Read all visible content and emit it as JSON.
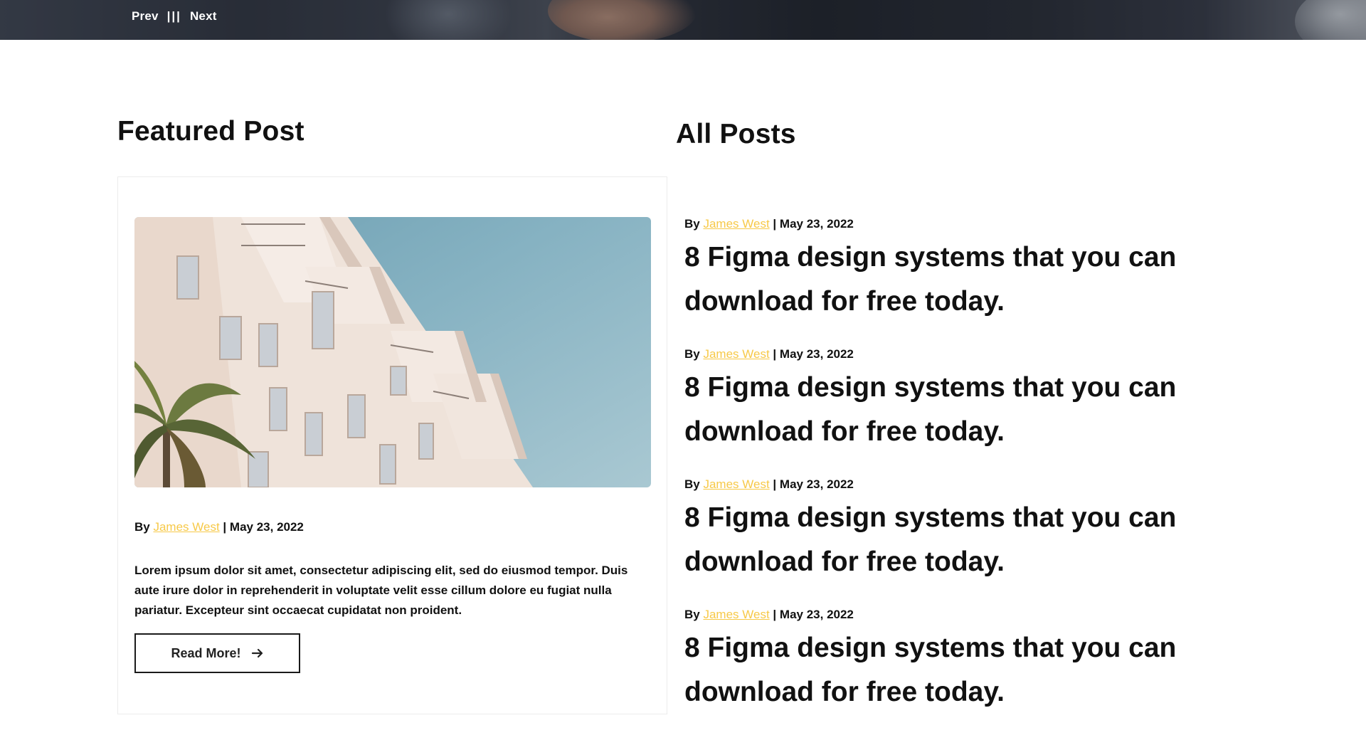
{
  "hero": {
    "prev_label": "Prev",
    "separator": "|||",
    "next_label": "Next"
  },
  "featured": {
    "heading": "Featured Post",
    "by": "By",
    "author": "James West",
    "date_sep": "|",
    "date": "May 23, 2022",
    "excerpt": "Lorem ipsum dolor sit amet, consectetur adipiscing elit, sed do eiusmod tempor. Duis aute irure dolor in reprehenderit in voluptate velit esse cillum dolore eu fugiat nulla pariatur. Excepteur sint occaecat cupidatat non proident.",
    "button_label": "Read More!",
    "button_icon": "arrow-right-icon"
  },
  "all_posts": {
    "heading": "All Posts",
    "items": [
      {
        "by": "By",
        "author": "James West",
        "date_sep": "|",
        "date": "May 23, 2022",
        "title": "8 Figma design systems that you can download for free today."
      },
      {
        "by": "By",
        "author": "James West",
        "date_sep": "|",
        "date": "May 23, 2022",
        "title": "8 Figma design systems that you can download for free today."
      },
      {
        "by": "By",
        "author": "James West",
        "date_sep": "|",
        "date": "May 23, 2022",
        "title": "8 Figma design systems that you can download for free today."
      },
      {
        "by": "By",
        "author": "James West",
        "date_sep": "|",
        "date": "May 23, 2022",
        "title": "8 Figma design systems that you can download for free today."
      }
    ]
  },
  "colors": {
    "accent_author": "#f7c948",
    "text": "#111111",
    "card_border": "#ececec"
  }
}
